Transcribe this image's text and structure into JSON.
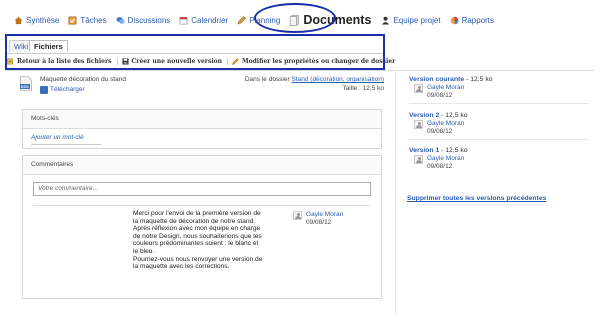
{
  "nav": {
    "items": [
      {
        "label": "Synthèse",
        "icon": "home-icon",
        "color": "#c0701e"
      },
      {
        "label": "Tâches",
        "icon": "tasks-icon",
        "color": "#c0701e"
      },
      {
        "label": "Discussions",
        "icon": "discussions-icon",
        "color": "#3a7bd5"
      },
      {
        "label": "Calendrier",
        "icon": "calendar-icon",
        "color": "#c04040"
      },
      {
        "label": "Planning",
        "icon": "planning-icon",
        "color": "#c0701e"
      },
      {
        "label": "Documents",
        "icon": "documents-icon",
        "color": "#888888",
        "active": true
      },
      {
        "label": "Equipe projet",
        "icon": "team-icon",
        "color": "#333333"
      },
      {
        "label": "Rapports",
        "icon": "reports-icon",
        "color": "#c0701e"
      }
    ]
  },
  "tabs": [
    "Wiki",
    "Fichiers"
  ],
  "toolbar": {
    "back": "Retour à la liste des fichiers",
    "new_version": "Créer une nouvelle version",
    "edit": "Modifier les propriétés ou changer de dossier"
  },
  "document": {
    "name": "Maquette décoration du stand",
    "download": "Télécharger",
    "folder_prefix": "Dans le dossier",
    "folder_link": "Stand (décoration, organisation)",
    "size": "Taille : 12,5 ko"
  },
  "keywords": {
    "title": "Mots-clés",
    "add": "Ajouter un mot-clé"
  },
  "comments": {
    "title": "Commentaires",
    "placeholder": "Votre commentaire...",
    "items": [
      {
        "lines": [
          "Merci pour l'envoi de la première version de",
          "la maquette de décoration de notre stand.",
          "Après réflexion avec mon équipe en charge",
          "de notre Design, nous souhaiterions que les",
          "couleurs prédominantes soient : le blanc et",
          "le bleu.",
          "Pourriez-vous nous renvoyer une version de",
          "la maquette avec les corrections."
        ],
        "author": "Gayle Moran",
        "date": "09/08/12"
      }
    ]
  },
  "versions": {
    "items": [
      {
        "label": "Version courante",
        "size": "-  12,5 ko",
        "author": "Gayle Moran",
        "date": "09/08/12"
      },
      {
        "label": "Version 2",
        "size": "-  12,5 ko",
        "author": "Gayle Moran",
        "date": "09/08/12"
      },
      {
        "label": "Version 1",
        "size": "-  12,5 ko",
        "author": "Gayle Moran",
        "date": "09/08/12"
      }
    ],
    "delete_all": "Supprimer toutes les versions précédentes"
  },
  "colors": {
    "highlight": "#1a2fa8",
    "link": "#2a5db0"
  }
}
